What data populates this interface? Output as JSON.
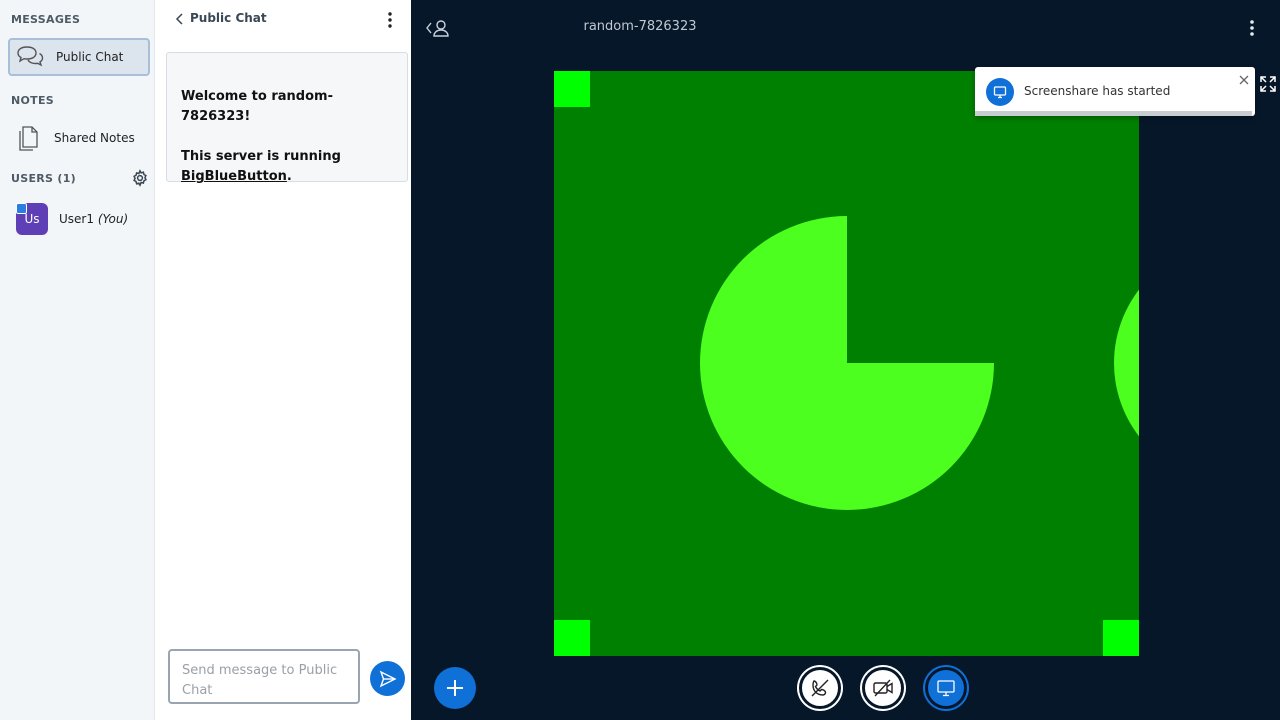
{
  "userlist": {
    "messages_title": "MESSAGES",
    "public_chat_label": "Public Chat",
    "notes_title": "NOTES",
    "shared_notes_label": "Shared Notes",
    "users_title": "USERS (1)",
    "users": [
      {
        "initials": "Us",
        "name": "User1",
        "suffix": "(You)"
      }
    ]
  },
  "chat": {
    "title": "Public Chat",
    "welcome_prefix": "Welcome to ",
    "meeting_name": "random-7826323",
    "welcome_suffix": "!",
    "server_line": "This server is running",
    "product_link": "BigBlueButton",
    "period": ".",
    "input_placeholder": "Send message to Public Chat"
  },
  "main": {
    "meeting_title": "random-7826323",
    "toast_message": "Screenshare has started",
    "toast_progress": 0.99
  },
  "colors": {
    "accent": "#0f70d7",
    "screen_bg": "#008000",
    "screen_shape": "#4cff1f",
    "screen_corner": "#00ff00",
    "avatar": "#5f3fb5"
  }
}
